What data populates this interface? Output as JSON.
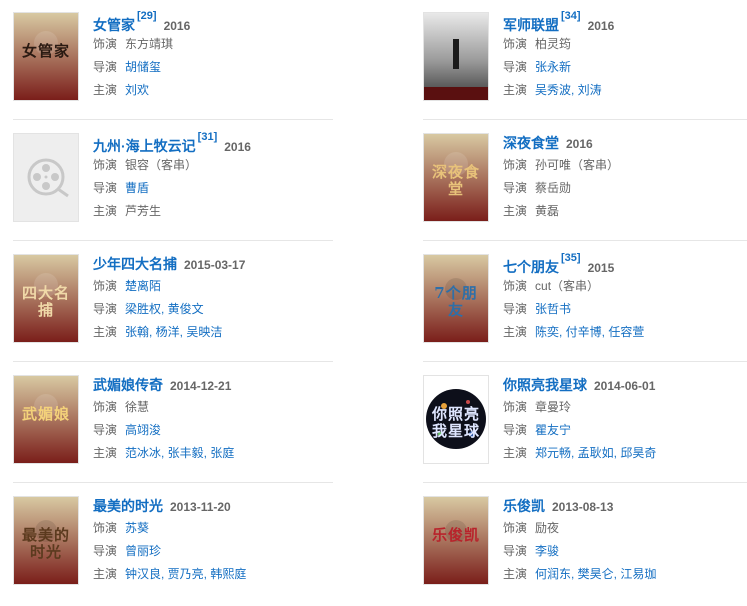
{
  "labels": {
    "role": "饰演",
    "director": "导演",
    "cast": "主演"
  },
  "films": [
    {
      "title": "女管家",
      "cite": "[29]",
      "date": "2016",
      "role": "东方靖琪",
      "role_link": false,
      "director": "胡储玺",
      "director_link": true,
      "cast": "刘欢",
      "cast_link": true,
      "poster": {
        "style": "art",
        "colors": [
          "#d8c9a2",
          "#7a1e1a"
        ],
        "text": "女管家",
        "text_color": "#2a1a12"
      }
    },
    {
      "title": "军师联盟",
      "cite": "[34]",
      "date": "2016",
      "role": "柏灵筠",
      "role_link": false,
      "director": "张永新",
      "director_link": true,
      "cast": "吴秀波, 刘涛",
      "cast_link": true,
      "poster": {
        "style": "photo",
        "colors": [
          "#e9e9e9",
          "#3a3a3a"
        ],
        "text": "",
        "text_color": "#ffffff"
      }
    },
    {
      "title": "九州·海上牧云记",
      "cite": "[31]",
      "date": "2016",
      "role": "银容（客串）",
      "role_link": false,
      "director": "曹盾",
      "director_link": true,
      "cast": "芦芳生",
      "cast_link": false,
      "poster": {
        "style": "placeholder",
        "colors": [
          "#eeeeee",
          "#c8c8c8"
        ],
        "text": "",
        "text_color": "#999999"
      }
    },
    {
      "title": "深夜食堂",
      "cite": "",
      "date": "2016",
      "role": "孙可唯（客串）",
      "role_link": false,
      "director": "蔡岳勋",
      "director_link": false,
      "cast": "黄磊",
      "cast_link": false,
      "poster": {
        "style": "dark",
        "colors": [
          "#1e1a14",
          "#a5742b"
        ],
        "text": "深夜食堂",
        "text_color": "#e8c27a"
      }
    },
    {
      "title": "少年四大名捕",
      "cite": "",
      "date": "2015-03-17",
      "role": "楚离陌",
      "role_link": true,
      "director": "梁胜权, 黄俊文",
      "director_link": true,
      "cast": "张翰, 杨洋, 吴映洁",
      "cast_link": true,
      "poster": {
        "style": "dark",
        "colors": [
          "#2b2a2e",
          "#8a2c24"
        ],
        "text": "四大名捕",
        "text_color": "#f0d9a8"
      }
    },
    {
      "title": "七个朋友",
      "cite": "[35]",
      "date": "2015",
      "role": "cut（客串）",
      "role_link": false,
      "director": "张哲书",
      "director_link": true,
      "cast": "陈奕, 付辛博, 任容萱",
      "cast_link": true,
      "poster": {
        "style": "bright",
        "colors": [
          "#bfe4f4",
          "#e98c6e"
        ],
        "text": "7个朋友",
        "text_color": "#2e6fa8"
      }
    },
    {
      "title": "武媚娘传奇",
      "cite": "",
      "date": "2014-12-21",
      "role": "徐慧",
      "role_link": false,
      "director": "高翊浚",
      "director_link": true,
      "cast": "范冰冰, 张丰毅, 张庭",
      "cast_link": true,
      "poster": {
        "style": "dark",
        "colors": [
          "#3a1d2a",
          "#c23a44"
        ],
        "text": "武媚娘",
        "text_color": "#f4d27a"
      }
    },
    {
      "title": "你照亮我星球",
      "cite": "",
      "date": "2014-06-01",
      "role": "章曼玲",
      "role_link": false,
      "director": "瞿友宁",
      "director_link": true,
      "cast": "郑元畅, 孟耿如, 邱昊奇",
      "cast_link": true,
      "poster": {
        "style": "planet",
        "colors": [
          "#0d0f1a",
          "#2f5aa6"
        ],
        "text": "你照亮我星球",
        "text_color": "#dfe6ff"
      }
    },
    {
      "title": "最美的时光",
      "cite": "",
      "date": "2013-11-20",
      "role": "苏葵",
      "role_link": true,
      "director": "曾丽珍",
      "director_link": true,
      "cast": "钟汉良, 贾乃亮, 韩熙庭",
      "cast_link": true,
      "poster": {
        "style": "bright",
        "colors": [
          "#f2e3c8",
          "#8a6a3c"
        ],
        "text": "最美的时光",
        "text_color": "#5b3a1e"
      }
    },
    {
      "title": "乐俊凯",
      "cite": "",
      "date": "2013-08-13",
      "role": "励夜",
      "role_link": false,
      "director": "李骏",
      "director_link": true,
      "cast": "何润东, 樊昊仑, 江易珈",
      "cast_link": true,
      "poster": {
        "style": "bright",
        "colors": [
          "#f4f1ee",
          "#b8232b"
        ],
        "text": "乐俊凯",
        "text_color": "#b8232b"
      }
    }
  ]
}
